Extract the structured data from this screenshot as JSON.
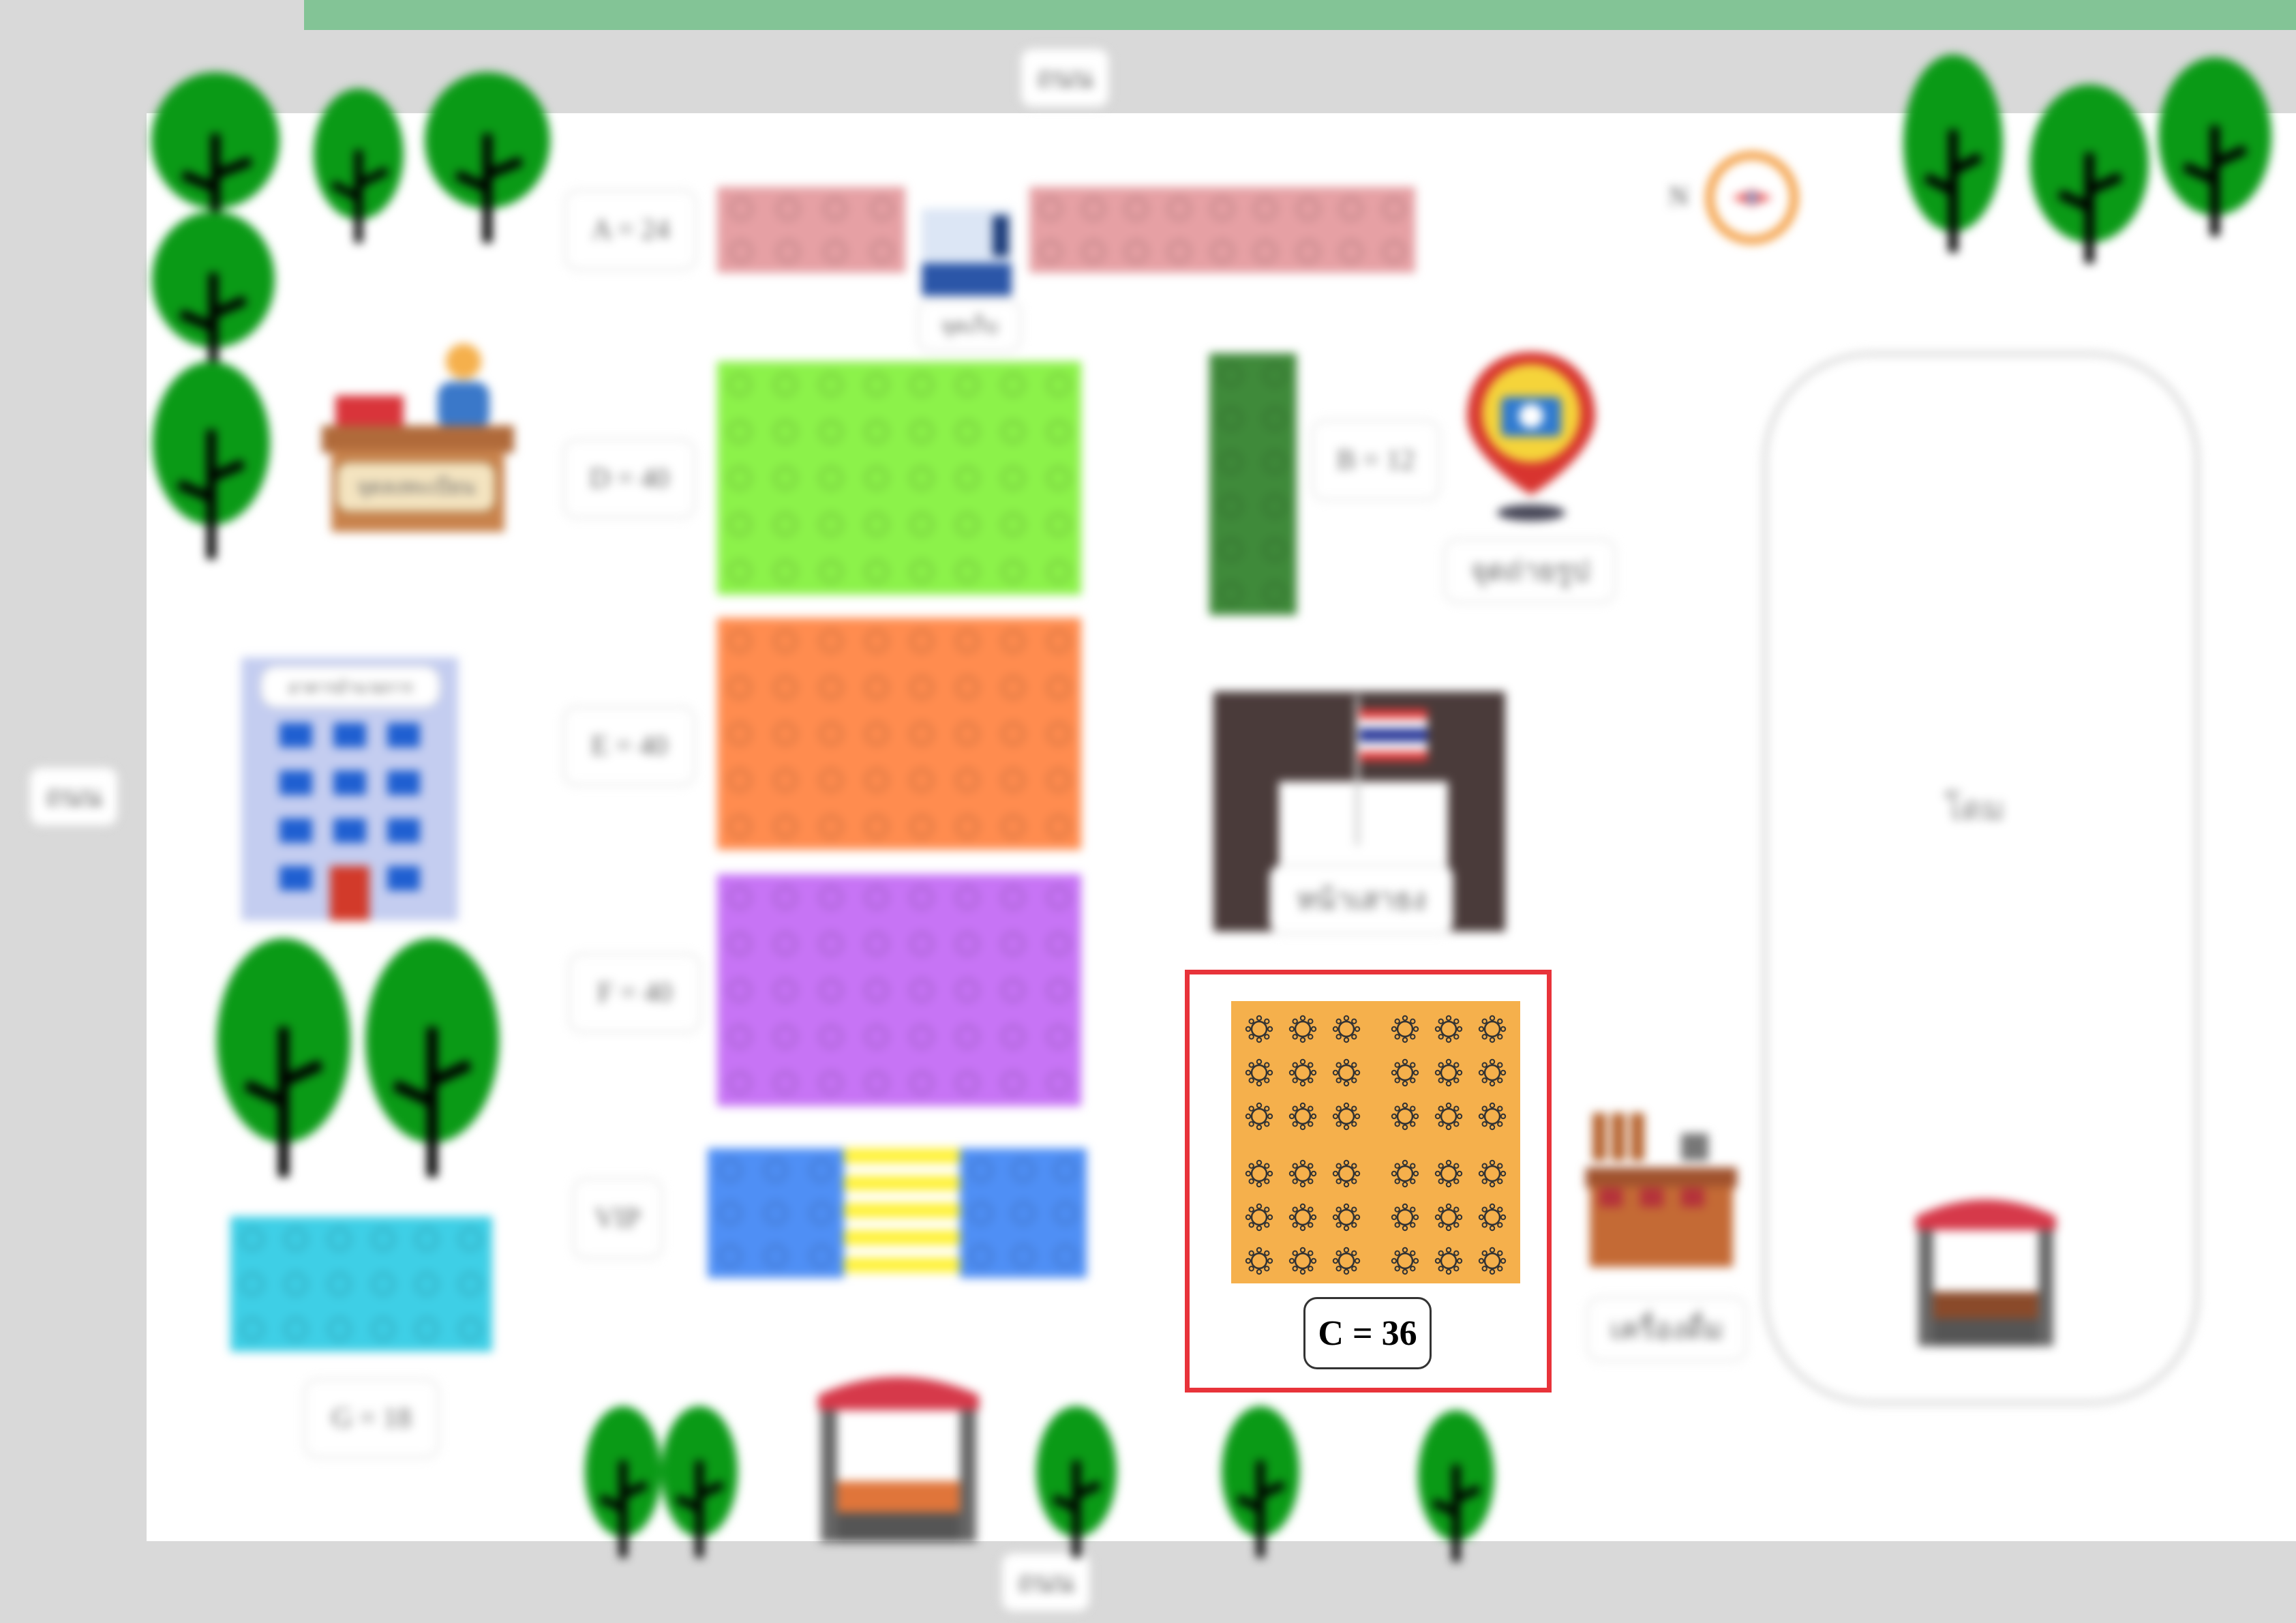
{
  "roads": {
    "top": "ถนน",
    "left": "ถนน",
    "bottom": "ถนน"
  },
  "compass": {
    "north_label": "N"
  },
  "zones": {
    "a": {
      "label": "A = 24",
      "color": "#e6a0a4"
    },
    "b": {
      "label": "B = 12",
      "color": "#3f8a3a"
    },
    "c": {
      "label": "C = 36",
      "color": "#f5b04c"
    },
    "d": {
      "label": "D = 40",
      "color": "#8cf24a"
    },
    "e": {
      "label": "E = 40",
      "color": "#ff8c4f"
    },
    "f": {
      "label": "F = 40",
      "color": "#c774f5"
    },
    "g": {
      "label": "G = 18",
      "color": "#3ecfe6"
    },
    "vip": {
      "label": "VIP",
      "color": "#4f8ff5",
      "aisle_color": "#fff23a"
    }
  },
  "landmarks": {
    "registration": "จุดลงทะเบียน",
    "building_sign": "อาคารอำนวยการ",
    "photo_spot": "จุดถ่ายรูป",
    "restroom_sign": "จุดเก็บ",
    "stage_flag": "หน้าเสาธง",
    "drinks": "เครื่องดื่ม",
    "field": "โดม"
  },
  "highlight": {
    "color": "#e8333a"
  }
}
